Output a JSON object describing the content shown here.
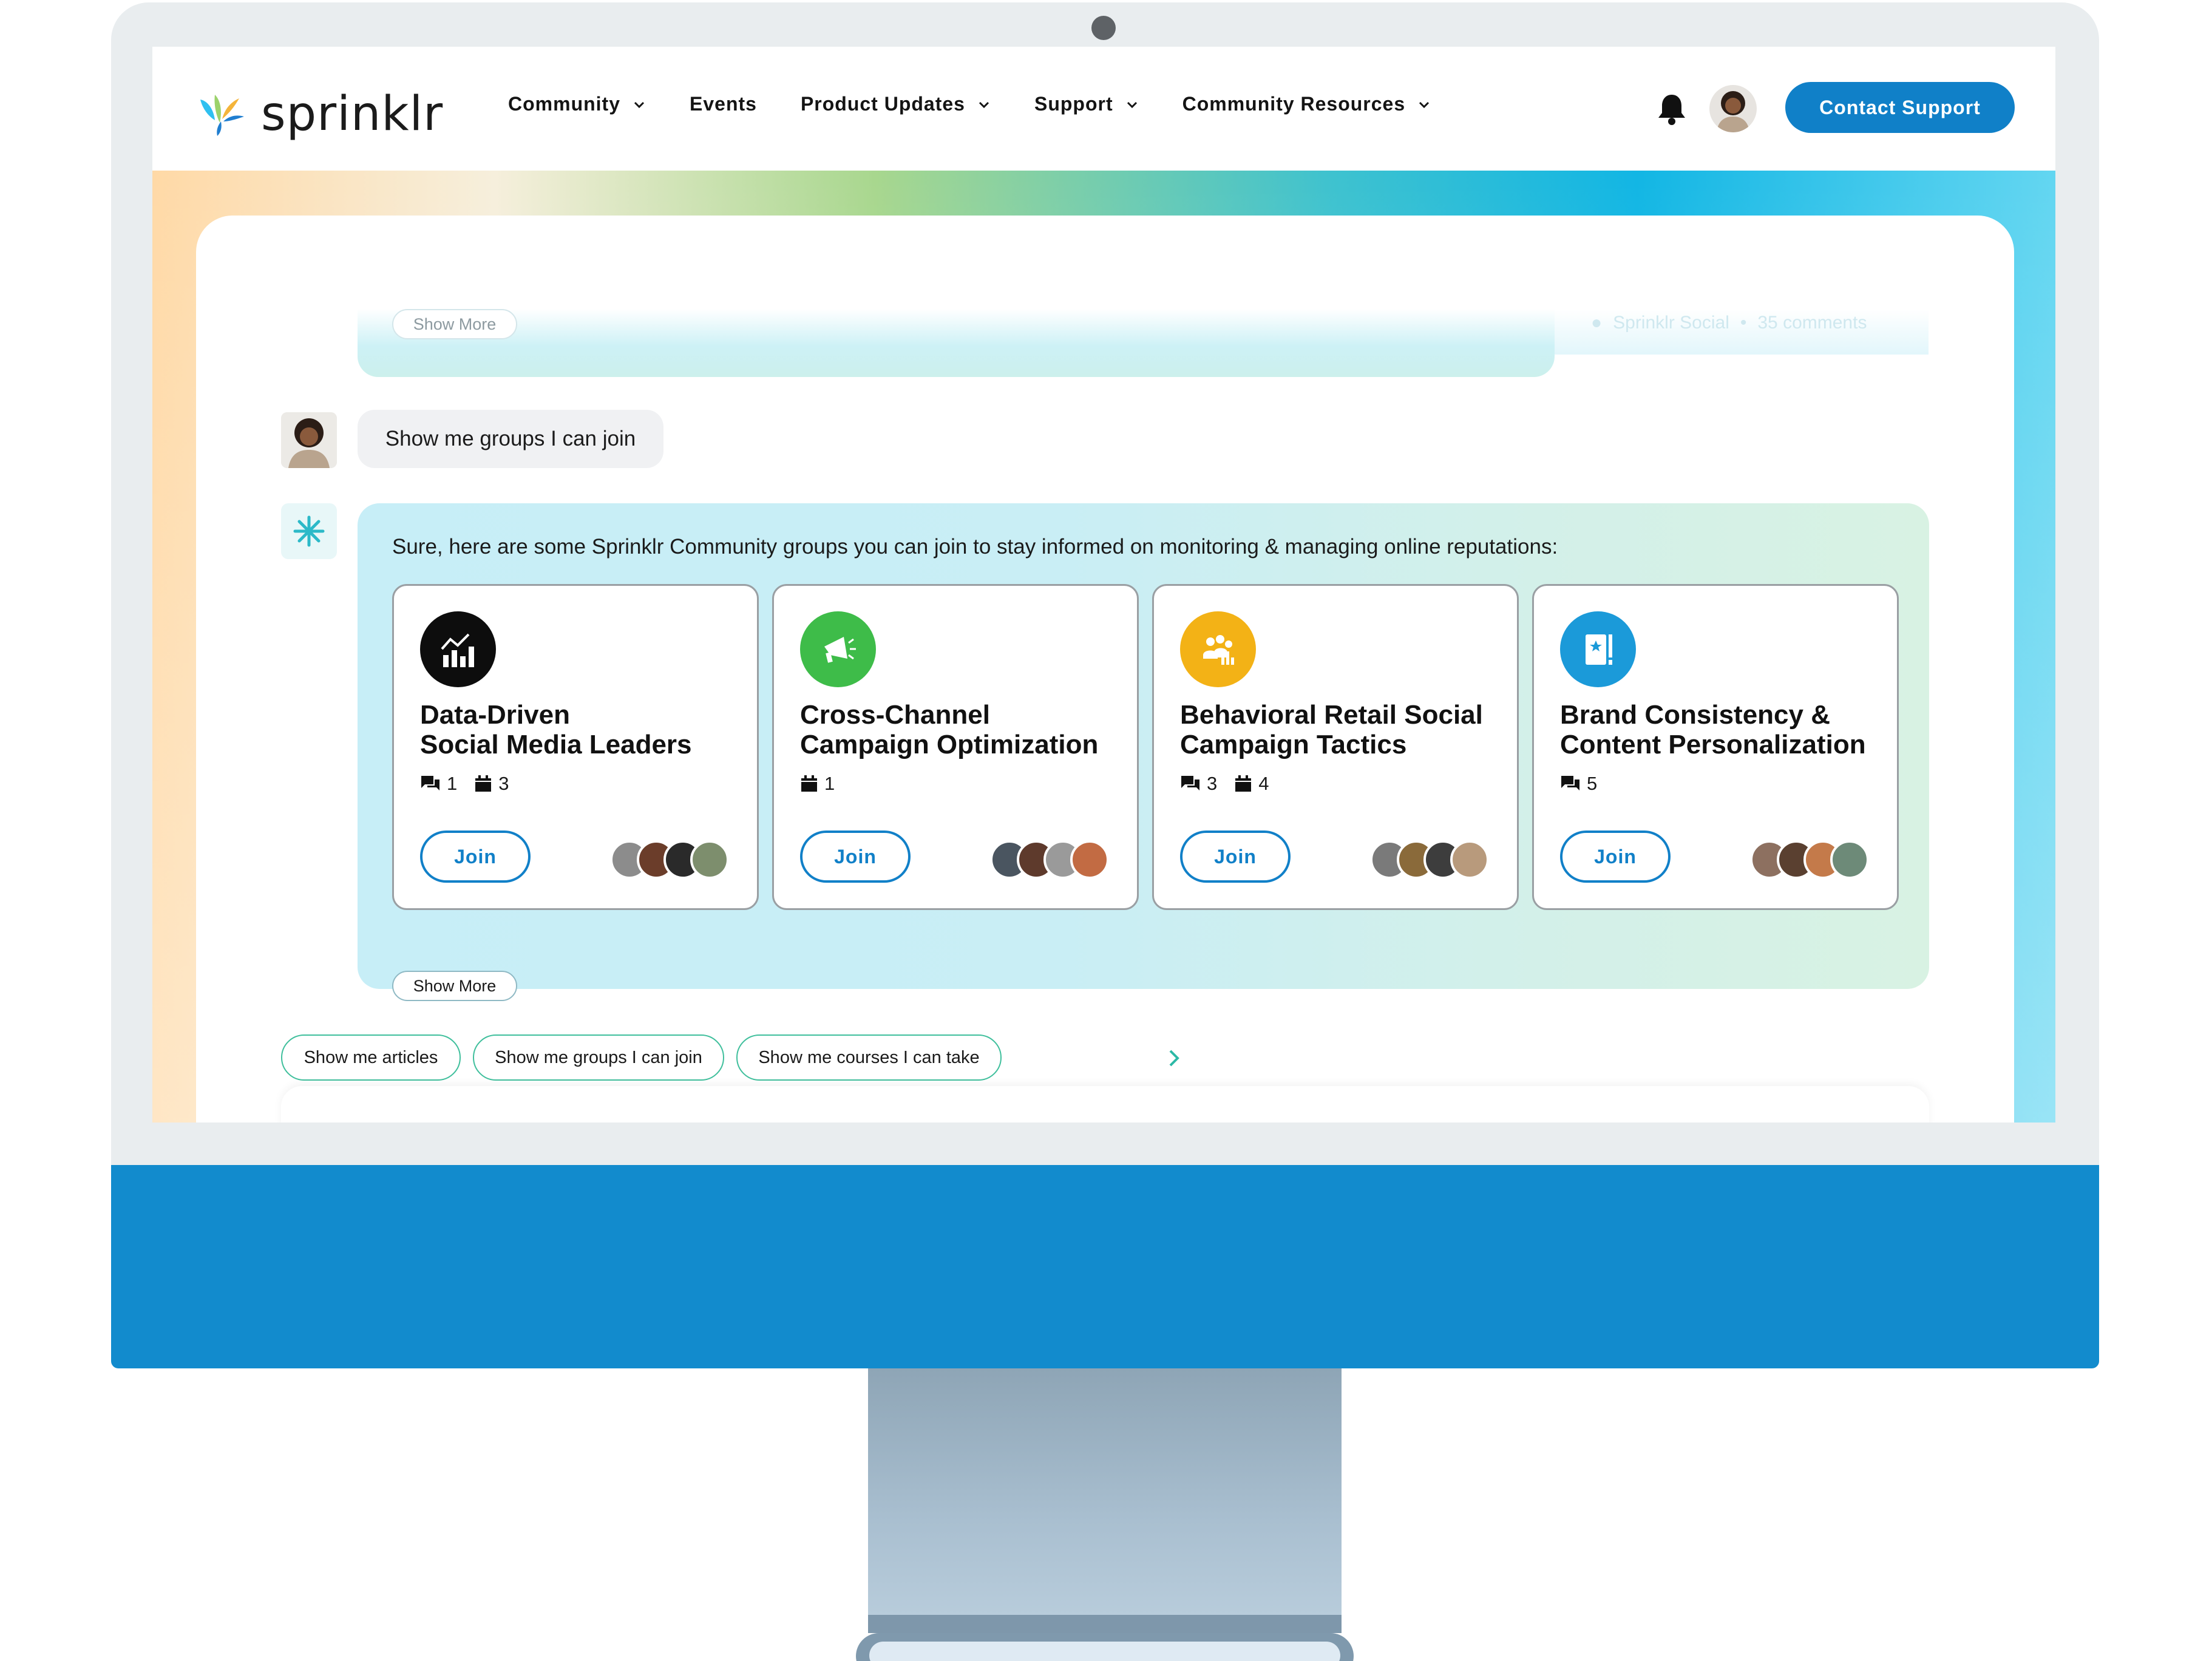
{
  "header": {
    "logo_text": "sprinklr",
    "nav": [
      {
        "label": "Community",
        "dropdown": true
      },
      {
        "label": "Events",
        "dropdown": false
      },
      {
        "label": "Product Updates",
        "dropdown": true
      },
      {
        "label": "Support",
        "dropdown": true
      },
      {
        "label": "Community Resources",
        "dropdown": true
      }
    ],
    "contact_button": "Contact Support",
    "icons": {
      "bell": "bell-icon",
      "avatar": "user-avatar"
    }
  },
  "previous_message": {
    "show_more": "Show More",
    "meta_source": "Sprinklr Social",
    "meta_comments": "35 comments"
  },
  "user_message": {
    "text": "Show me groups I can join"
  },
  "bot_message": {
    "text": "Sure, here are some Sprinklr Community groups you can join to stay informed on monitoring & managing online reputations:",
    "groups": [
      {
        "title_line1": "Data-Driven",
        "title_line2": "Social Media Leaders",
        "icon": "analytics-chart-icon",
        "icon_bg": "#0d0d0d",
        "discussions": "1",
        "events": "3",
        "join": "Join"
      },
      {
        "title_line1": "Cross-Channel",
        "title_line2": "Campaign Optimization",
        "icon": "megaphone-icon",
        "icon_bg": "#3ebc49",
        "discussions": null,
        "events": "1",
        "join": "Join"
      },
      {
        "title_line1": "Behavioral Retail Social",
        "title_line2": "Campaign Tactics",
        "icon": "people-group-icon",
        "icon_bg": "#f3b216",
        "discussions": "3",
        "events": "4",
        "join": "Join"
      },
      {
        "title_line1": "Brand Consistency &",
        "title_line2": "Content Personalization",
        "icon": "brand-book-icon",
        "icon_bg": "#1b9ad9",
        "discussions": "5",
        "events": null,
        "join": "Join"
      }
    ],
    "show_more": "Show More"
  },
  "suggestions": [
    "Show me articles",
    "Show me groups I can join",
    "Show me courses I can take"
  ],
  "colors": {
    "accent": "#1080c8",
    "chip_border": "#3fbf9c",
    "monitor_chin": "#128bcd"
  }
}
